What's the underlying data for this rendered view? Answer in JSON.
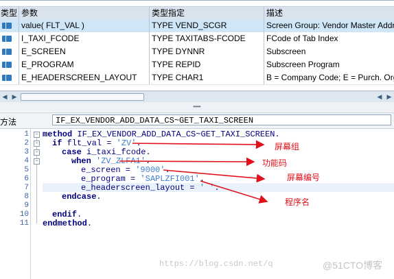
{
  "params_table": {
    "headers": [
      "类型",
      "参数",
      "类型指定",
      "描述"
    ],
    "rows": [
      {
        "param": "value( FLT_VAL )",
        "type": "TYPE VEND_SCGR",
        "desc": "Screen Group: Vendor Master Address"
      },
      {
        "param": "I_TAXI_FCODE",
        "type": "TYPE TAXITABS-FCODE",
        "desc": "FCode of Tab Index"
      },
      {
        "param": "E_SCREEN",
        "type": "TYPE DYNNR",
        "desc": "Subscreen"
      },
      {
        "param": "E_PROGRAM",
        "type": "TYPE REPID",
        "desc": "Subscreen Program"
      },
      {
        "param": "E_HEADERSCREEN_LAYOUT",
        "type": "TYPE CHAR1",
        "desc": "B = Company Code; E = Purch. Org"
      }
    ]
  },
  "method_bar": {
    "label": "方法",
    "value": "IF_EX_VENDOR_ADD_DATA_CS~GET_TAXI_SCREEN"
  },
  "code": {
    "line_numbers": [
      "1",
      "2",
      "3",
      "4",
      "5",
      "6",
      "7",
      "8",
      "9",
      "10",
      "11"
    ],
    "l1_kw": "method",
    "l1_rest": " IF_EX_VENDOR_ADD_DATA_CS~GET_TAXI_SCREEN.",
    "l2_kw": "if",
    "l2_mid": " flt_val = ",
    "l2_str": "'ZV'",
    "l2_end": ".",
    "l3_kw": "case",
    "l3_rest": " i_taxi_fcode.",
    "l4_kw": "when",
    "l4_sp": " ",
    "l4_str": "'ZV_ZLFA1'",
    "l4_end": ".",
    "l5_mid": "e_screen = ",
    "l5_str": "'9000'",
    "l5_end": ".",
    "l6_mid": "e_program = ",
    "l6_str": "'SAPLZFI001'",
    "l6_end": ".",
    "l7_mid": "e_headerscreen_layout = ",
    "l7_str": "' '",
    "l7_end": ".",
    "l8_kw": "endcase",
    "l8_end": ".",
    "l10_kw": "endif",
    "l10_end": ".",
    "l11_kw": "endmethod",
    "l11_end": "."
  },
  "annotations": [
    "屏幕组",
    "功能码",
    "屏幕编号",
    "程序名"
  ],
  "annotation_color": "#e0111b",
  "watermark": "https://blog.csdn.net/q",
  "watermark_logo": "@51CTO博客"
}
